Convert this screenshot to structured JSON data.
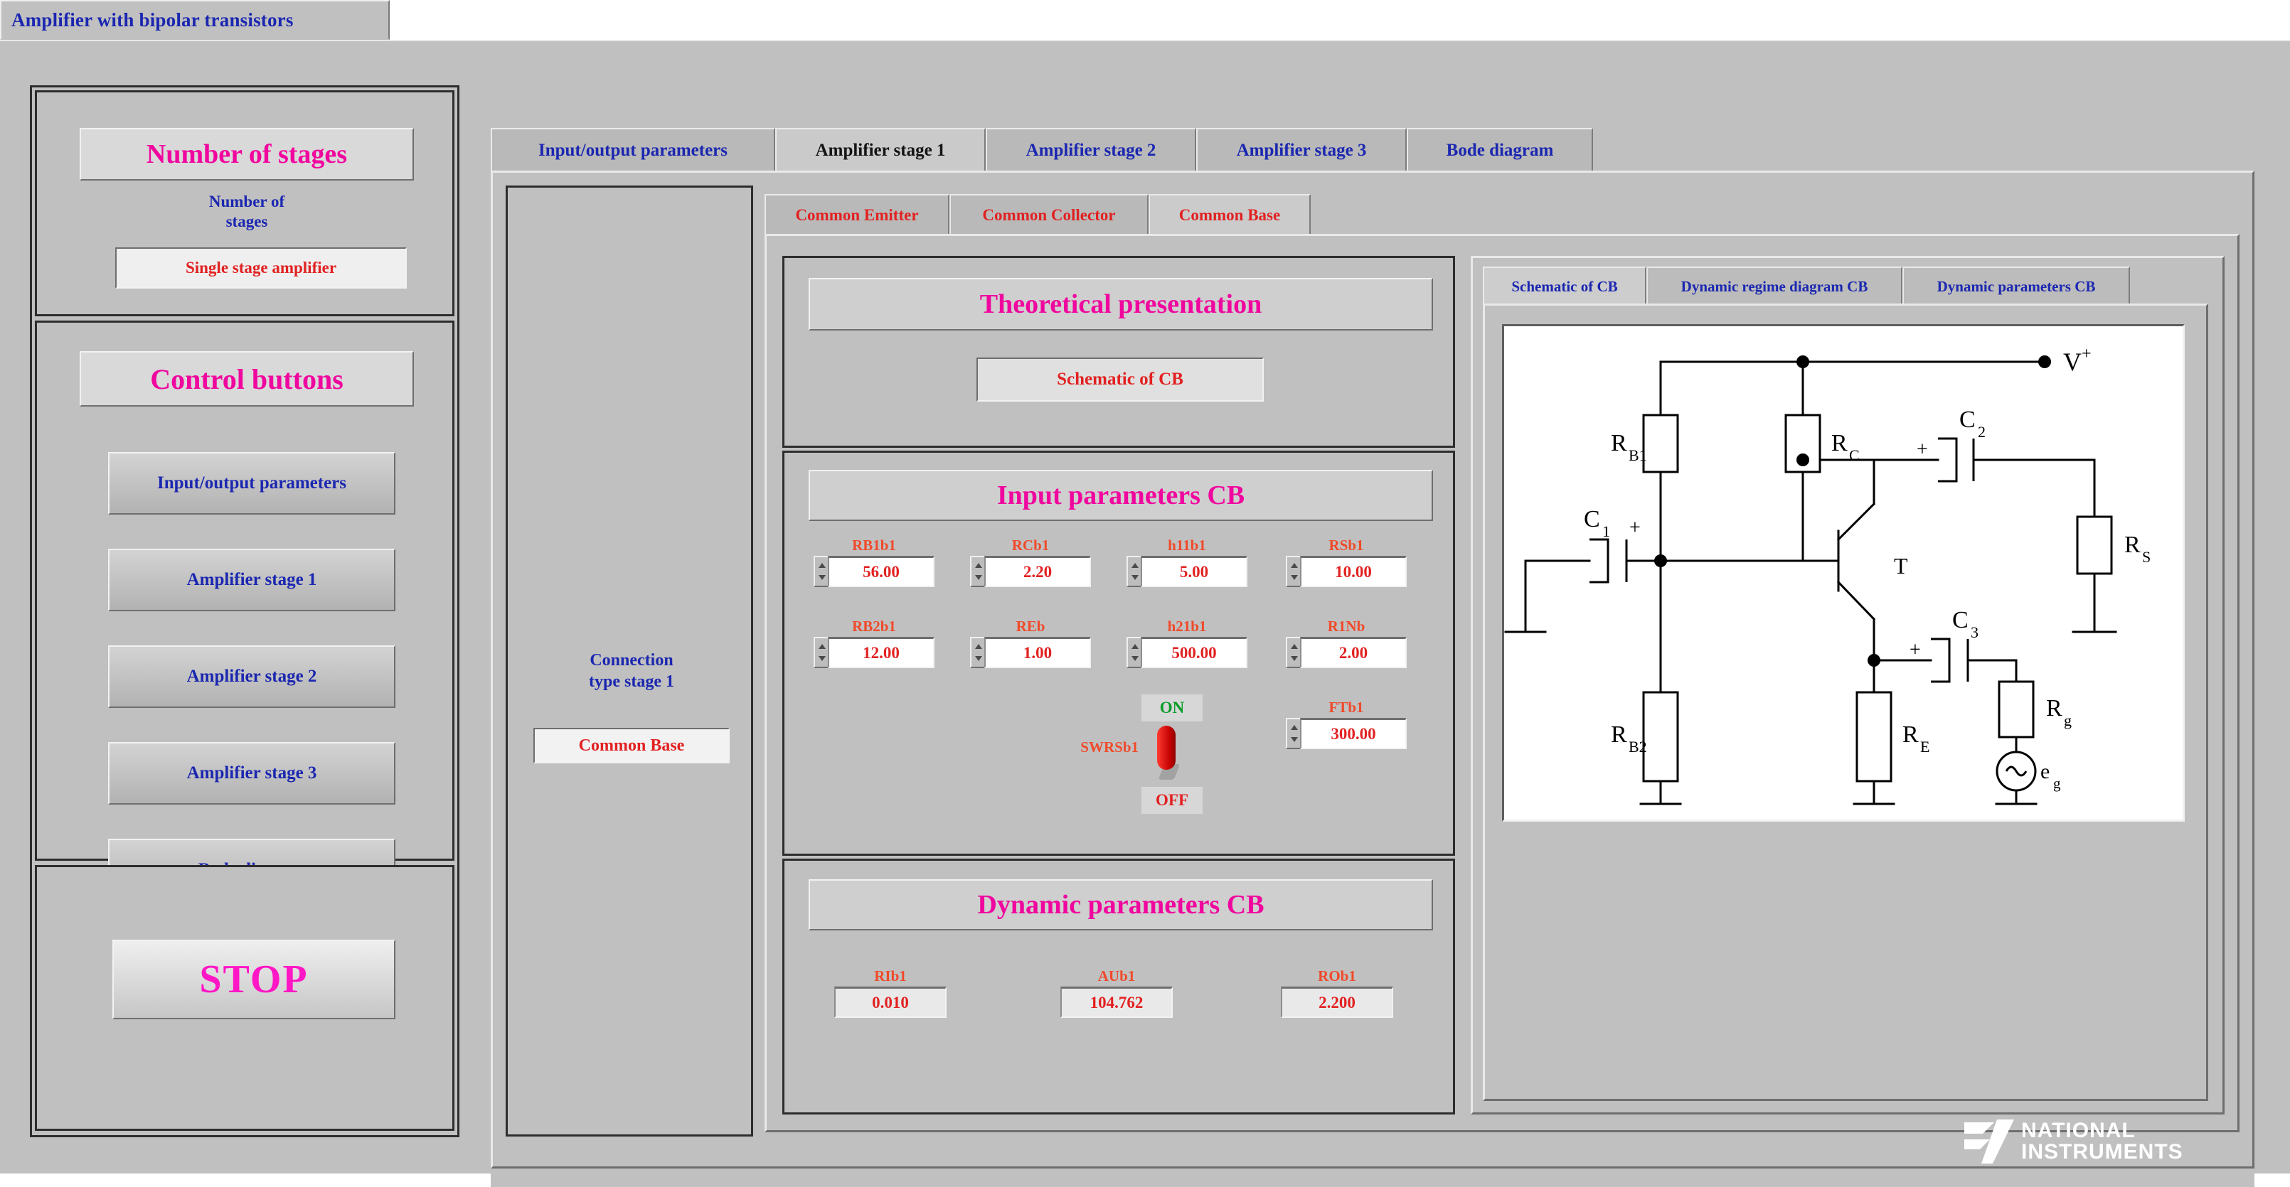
{
  "window": {
    "title": "Amplifier with bipolar transistors"
  },
  "sidebar": {
    "stages": {
      "banner": "Number of stages",
      "label": "Number of\nstages",
      "value": "Single stage amplifier"
    },
    "controls": {
      "banner": "Control buttons",
      "buttons": [
        {
          "label": "Input/output parameters"
        },
        {
          "label": "Amplifier stage 1"
        },
        {
          "label": "Amplifier stage 2"
        },
        {
          "label": "Amplifier stage 3"
        },
        {
          "label": "Bode diagram"
        }
      ]
    },
    "stop": {
      "label": "STOP"
    }
  },
  "main": {
    "tabs": [
      {
        "label": "Input/output parameters",
        "active": false
      },
      {
        "label": "Amplifier stage 1",
        "active": true
      },
      {
        "label": "Amplifier stage 2",
        "active": false
      },
      {
        "label": "Amplifier stage 3",
        "active": false
      },
      {
        "label": "Bode diagram",
        "active": false
      }
    ],
    "connection": {
      "label": "Connection\ntype stage 1",
      "value": "Common Base"
    },
    "subtabs": [
      {
        "label": "Common Emitter",
        "active": false
      },
      {
        "label": "Common Collector",
        "active": false
      },
      {
        "label": "Common Base",
        "active": true
      }
    ],
    "theory": {
      "header": "Theoretical presentation",
      "button": "Schematic of CB"
    },
    "input_parameters": {
      "header": "Input parameters CB",
      "fields": [
        {
          "name": "RB1b1",
          "value": "56.00"
        },
        {
          "name": "RCb1",
          "value": "2.20"
        },
        {
          "name": "h11b1",
          "value": "5.00"
        },
        {
          "name": "RSb1",
          "value": "10.00"
        },
        {
          "name": "RB2b1",
          "value": "12.00"
        },
        {
          "name": "REb",
          "value": "1.00"
        },
        {
          "name": "h21b1",
          "value": "500.00"
        },
        {
          "name": "R1Nb",
          "value": "2.00"
        },
        {
          "name": "FTb1",
          "value": "300.00"
        }
      ],
      "switch": {
        "name": "SWRSb1",
        "on_label": "ON",
        "off_label": "OFF",
        "state": "on"
      }
    },
    "dynamic_parameters": {
      "header": "Dynamic parameters CB",
      "fields": [
        {
          "name": "RIb1",
          "value": "0.010"
        },
        {
          "name": "AUb1",
          "value": "104.762"
        },
        {
          "name": "ROb1",
          "value": "2.200"
        }
      ]
    },
    "schematic": {
      "tabs": [
        {
          "label": "Schematic of CB",
          "active": true
        },
        {
          "label": "Dynamic regime diagram CB",
          "active": false
        },
        {
          "label": "Dynamic parameters CB",
          "active": false
        }
      ],
      "circuit_labels": {
        "rb1": "R",
        "rb1_sub": "B1",
        "rb2": "R",
        "rb2_sub": "B2",
        "rc": "R",
        "rc_sub": "C",
        "re": "R",
        "re_sub": "E",
        "rs": "R",
        "rs_sub": "S",
        "rg": "R",
        "rg_sub": "g",
        "c1": "C",
        "c1_sub": "1",
        "c2": "C",
        "c2_sub": "2",
        "c3": "C",
        "c3_sub": "3",
        "transistor": "T",
        "source": "e",
        "source_sub": "g",
        "supply": "V",
        "supply_sup": "+",
        "plus": "+"
      }
    }
  },
  "branding": {
    "line1": "NATIONAL",
    "line2": "INSTRUMENTS"
  },
  "colors": {
    "magenta": "#f0069e",
    "blue": "#1b27b0",
    "red": "#e22121",
    "orange_red": "#f04a2a",
    "green": "#0b9c28",
    "panel": "#c0c0c0"
  }
}
